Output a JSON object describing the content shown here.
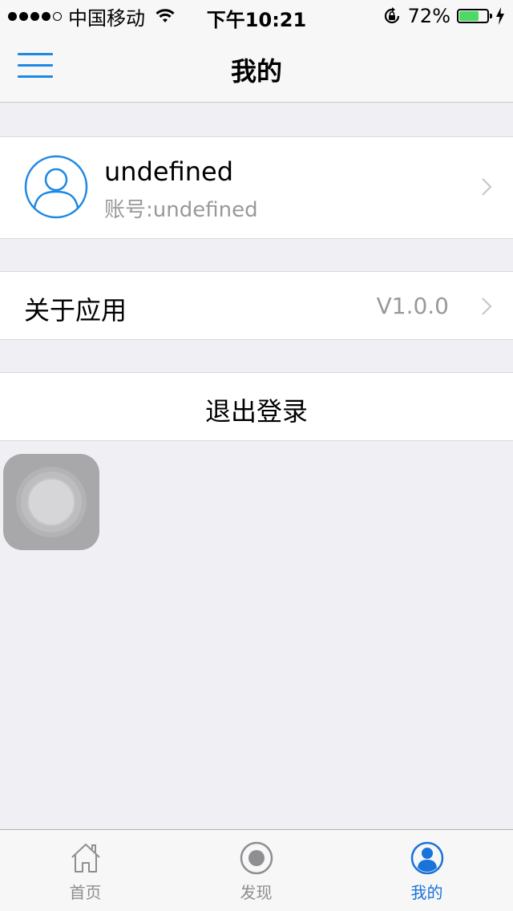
{
  "status_bar": {
    "carrier": "中国移动",
    "time": "下午10:21",
    "battery_percent": "72%",
    "battery_level": 0.72
  },
  "nav": {
    "title": "我的",
    "menu_icon": "hamburger-menu-icon"
  },
  "profile": {
    "name": "undefined",
    "account": "账号:undefined",
    "avatar_icon": "user-avatar-icon"
  },
  "about": {
    "label": "关于应用",
    "version": "V1.0.0"
  },
  "logout": {
    "label": "退出登录"
  },
  "tabbar": {
    "tabs": [
      {
        "label": "首页",
        "icon": "home-icon",
        "active": false
      },
      {
        "label": "发现",
        "icon": "discover-icon",
        "active": false
      },
      {
        "label": "我的",
        "icon": "profile-icon",
        "active": true
      }
    ]
  },
  "colors": {
    "accent": "#1a73d9",
    "background": "#efeff4",
    "battery_green": "#4cd964"
  }
}
